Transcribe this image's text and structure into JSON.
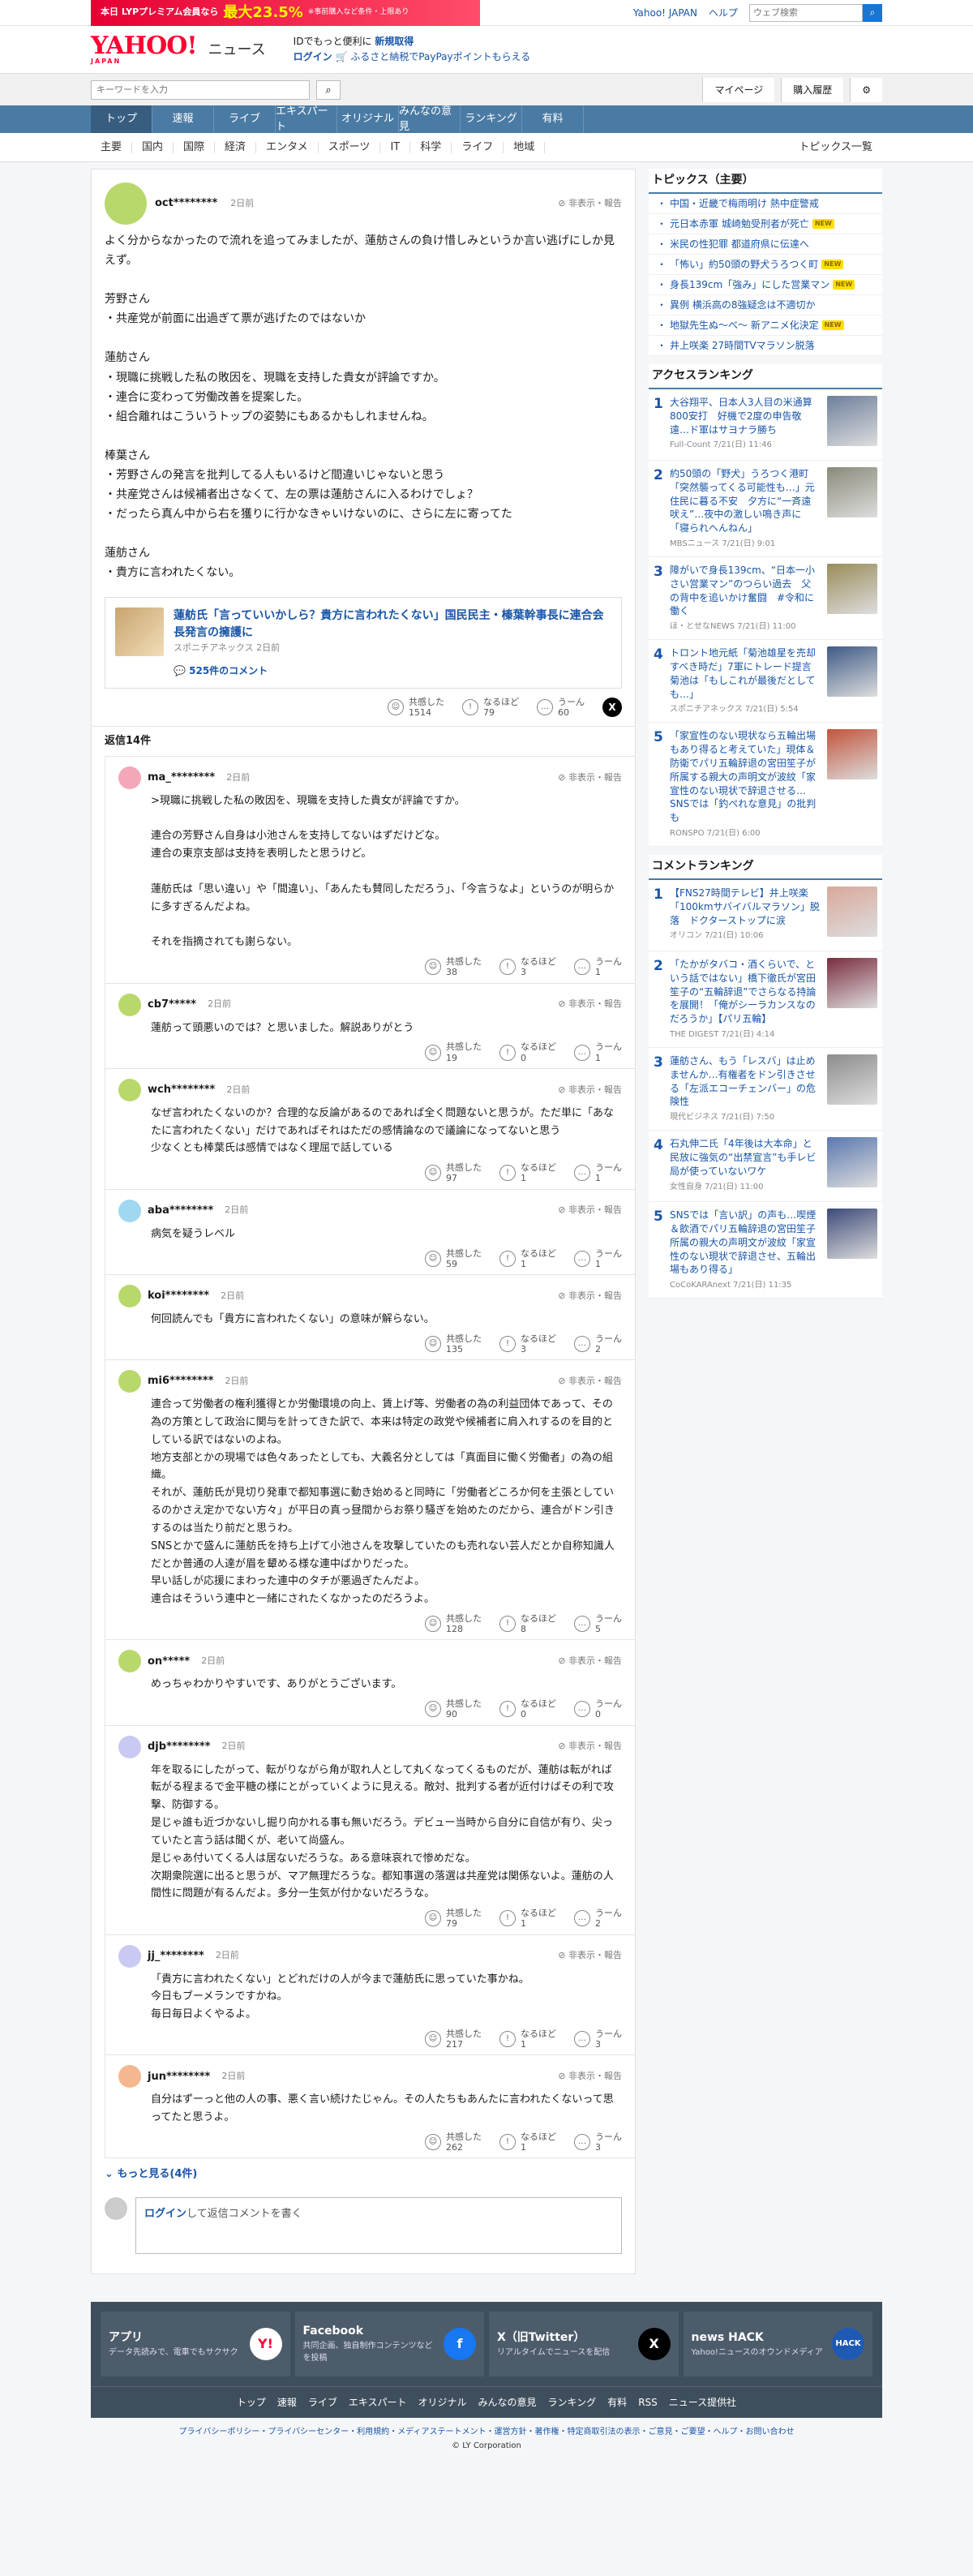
{
  "promo": {
    "label": "本日 LYPプレミアム会員なら",
    "pct": "最大23.5%",
    "note": "※事前購入など条件・上限あり"
  },
  "topbar": {
    "links": [
      "Yahoo! JAPAN",
      "ヘルプ"
    ],
    "search_placeholder": "ウェブ検索"
  },
  "brand": {
    "logo": "YAHOO!",
    "logo_sub": "JAPAN",
    "section": "ニュース",
    "id_text": "IDでもっと便利に",
    "id_link": "新規取得",
    "login": "ログイン",
    "furusato": "ふるさと納税でPayPayポイントもらえる"
  },
  "search": {
    "placeholder": "キーワードを入力",
    "mypage": "マイページ",
    "history": "購入履歴"
  },
  "mainnav": [
    "トップ",
    "速報",
    "ライブ",
    "エキスパート",
    "オリジナル",
    "みんなの意見",
    "ランキング",
    "有料"
  ],
  "subnav": [
    "主要",
    "国内",
    "国際",
    "経済",
    "エンタメ",
    "スポーツ",
    "IT",
    "科学",
    "ライフ",
    "地域"
  ],
  "subnav_right": "トピックス一覧",
  "comment": {
    "user": "oct********",
    "ago": "2日前",
    "report": "非表示・報告",
    "body": "よく分からなかったので流れを追ってみましたが、蓮舫さんの負け惜しみというか言い逃げにしか見えず。\n\n芳野さん\n・共産党が前面に出過ぎて票が逃げたのではないか\n\n蓮舫さん\n・現職に挑戦した私の敗因を、現職を支持した貴女が評論ですか。\n・連合に変わって労働改善を提案した。\n・組合離れはこういうトップの姿勢にもあるかもしれませんね。\n\n棒葉さん\n・芳野さんの発言を批判してる人もいるけど間違いじゃないと思う\n・共産党さんは候補者出さなくて、左の票は蓮舫さんに入るわけでしょ？\n・だったら真ん中から右を獲りに行かなきゃいけないのに、さらに左に寄ってた\n\n蓮舫さん\n・貴方に言われたくない。",
    "card": {
      "title": "蓮舫氏「言っていいかしら？貴方に言われたくない」国民民主・榛葉幹事長に連合会長発言の擁護に",
      "meta": "スポニチアネックス 2日前",
      "count": "525件のコメント"
    },
    "reactions": [
      {
        "label": "共感した",
        "count": "1514"
      },
      {
        "label": "なるほど",
        "count": "79"
      },
      {
        "label": "うーん",
        "count": "60"
      }
    ],
    "reply_count": "返信14件"
  },
  "colors": {
    "avatar_main": "#b9d86c",
    "accent": "#1855a8",
    "nav": "#4a7ba4"
  },
  "reaction_labels": [
    "共感した",
    "なるほど",
    "うーん"
  ],
  "replies": [
    {
      "user": "ma_********",
      "ago": "2日前",
      "avatar": "#f4a7b9",
      "body": ">現職に挑戦した私の敗因を、現職を支持した貴女が評論ですか。\n\n連合の芳野さん自身は小池さんを支持してないはずだけどな。\n連合の東京支部は支持を表明したと思うけど。\n\n蓮舫氏は「思い違い」や「間違い」、「あんたも賛同しただろう」、「今言うなよ」というのが明らかに多すぎるんだよね。\n\nそれを指摘されても謝らない。",
      "counts": [
        "38",
        "3",
        "1"
      ]
    },
    {
      "user": "cb7*****",
      "ago": "2日前",
      "avatar": "#b9d86c",
      "body": "蓮舫って頭悪いのでは？と思いました。解説ありがとう",
      "counts": [
        "19",
        "0",
        "1"
      ]
    },
    {
      "user": "wch********",
      "ago": "2日前",
      "avatar": "#b9d86c",
      "body": "なぜ言われたくないのか？合理的な反論があるのであれば全く問題ないと思うが。ただ単に「あなたに言われたくない」だけであればそれはただの感情論なので議論になってないと思う\n少なくとも棒葉氏は感情ではなく理屈で話している",
      "counts": [
        "97",
        "1",
        "1"
      ]
    },
    {
      "user": "aba********",
      "ago": "2日前",
      "avatar": "#9fd8f0",
      "body": "病気を疑うレベル",
      "counts": [
        "59",
        "1",
        "1"
      ]
    },
    {
      "user": "koi********",
      "ago": "2日前",
      "avatar": "#b9d86c",
      "body": "何回読んでも「貴方に言われたくない」の意味が解らない。",
      "counts": [
        "135",
        "3",
        "2"
      ]
    },
    {
      "user": "mi6********",
      "ago": "2日前",
      "avatar": "#b9d86c",
      "body": "連合って労働者の権利獲得とか労働環境の向上、賃上げ等、労働者の為の利益団体であって、その為の方策として政治に関与を計ってきた訳で、本来は特定の政党や候補者に肩入れするのを目的としている訳ではないのよね。\n地方支部とかの現場では色々あったとしても、大義名分としては「真面目に働く労働者」の為の組織。\nそれが、蓮舫氏が見切り発車で都知事選に動き始めると同時に「労働者どころか何を主張としているのかさえ定かでない方々」が平日の真っ昼間からお祭り騒ぎを始めたのだから、連合がドン引きするのは当たり前だと思うわ。\nSNSとかで盛んに蓮舫氏を持ち上げて小池さんを攻撃していたのも売れない芸人だとか自称知識人だとか普通の人達が眉を顰める様な連中ばかりだった。\n早い話しが応援にまわった連中のタチが悪過ぎたんだよ。\n連合はそういう連中と一緒にされたくなかったのだろうよ。",
      "counts": [
        "128",
        "8",
        "5"
      ]
    },
    {
      "user": "on*****",
      "ago": "2日前",
      "avatar": "#b9d86c",
      "body": "めっちゃわかりやすいです、ありがとうございます。",
      "counts": [
        "90",
        "0",
        "0"
      ]
    },
    {
      "user": "djb********",
      "ago": "2日前",
      "avatar": "#c9c9f2",
      "body": "年を取るにしたがって、転がりながら角が取れ人として丸くなってくるものだが、蓮舫は転がれば転がる程まるで金平糖の様にとがっていくように見える。敵対、批判する者が近付けばその利で攻撃、防御する。\n是じゃ誰も近づかないし掘り向かれる事も無いだろう。デビュー当時から自分に自信が有り、尖っていたと言う話は聞くが、老いて尚盛ん。\n是じゃあ付いてくる人は居ないだろうな。ある意味哀れで惨めだな。\n次期衆院選に出ると思うが、マア無理だろうな。都知事選の落選は共産党は関係ないよ。蓮舫の人間性に問題が有るんだよ。多分一生気が付かないだろうな。",
      "counts": [
        "79",
        "1",
        "2"
      ]
    },
    {
      "user": "jj_********",
      "ago": "2日前",
      "avatar": "#c9c9f2",
      "body": "「貴方に言われたくない」とどれだけの人が今まで蓮舫氏に思っていた事かね。\n今日もブーメランですかね。\n毎日毎日よくやるよ。",
      "counts": [
        "217",
        "1",
        "3"
      ]
    },
    {
      "user": "jun********",
      "ago": "2日前",
      "avatar": "#f4b78f",
      "body": "自分はずーっと他の人の事、悪く言い続けたじゃん。その人たちもあんたに言われたくないって思ってたと思うよ。",
      "counts": [
        "262",
        "1",
        "3"
      ]
    }
  ],
  "more": "もっと見る(4件)",
  "compose": {
    "login": "ログイン",
    "rest": "して返信コメントを書く"
  },
  "side": {
    "topics_title": "トピックス（主要）",
    "topics": [
      {
        "t": "中国・近畿で梅雨明け 熱中症警戒",
        "new": false
      },
      {
        "t": "元日本赤軍 城崎勉受刑者が死亡",
        "new": true
      },
      {
        "t": "米民の性犯罪 都道府県に伝達へ",
        "new": false
      },
      {
        "t": "「怖い」約50頭の野犬うろつく町",
        "new": true
      },
      {
        "t": "身長139cm「強み」にした営業マン",
        "new": true
      },
      {
        "t": "異例 横浜高の8強疑念は不適切か",
        "new": false
      },
      {
        "t": "地獄先生ぬ～べ～ 新アニメ化決定",
        "new": true
      },
      {
        "t": "井上咲楽 27時間TVマラソン脱落",
        "new": false
      }
    ],
    "access_title": "アクセスランキング",
    "access": [
      {
        "n": "1",
        "t": "大谷翔平、日本人3人目の米通算800安打　好機で2度の申告敬遠…ド軍はサヨナラ勝ち",
        "s": "Full-Count 7/21(日) 11:46",
        "c": "#6d7f9c"
      },
      {
        "n": "2",
        "t": "約50頭の「野犬」うろつく港町「突然襲ってくる可能性も…」元住民に暮る不安　夕方に“一斉遠吠え”…夜中の激しい鳴き声に「寝られへんねん」",
        "s": "MBSニュース 7/21(日) 9:01",
        "c": "#8a8a7a"
      },
      {
        "n": "3",
        "t": "障がいで身長139cm、“日本一小さい営業マン”のつらい過去　父の背中を追いかけ奮闘　#令和に働く",
        "s": "ほ・とせなNEWS 7/21(日) 11:00",
        "c": "#9a8c5a"
      },
      {
        "n": "4",
        "t": "トロント地元紙「菊池雄星を売却すべき時だ」7軍にトレード提言　菊池は「もしこれが最後だとしても…」",
        "s": "スポニチアネックス 7/21(日) 5:54",
        "c": "#3e5a86"
      },
      {
        "n": "5",
        "t": "「家宣性のない現状なら五輪出場もあり得ると考えていた」現体＆防衛でパリ五輪辞退の宮田笙子が所属する親大の声明文が波紋「家宣性のない現状で辞退させる…SNSでは「釣ぺれな意見」の批判も",
        "s": "RONSPO 7/21(日) 6:00",
        "c": "#c2543c"
      }
    ],
    "comment_title": "コメントランキング",
    "comment_rank": [
      {
        "n": "1",
        "t": "【FNS27時間テレビ】井上咲楽「100kmサバイバルマラソン」脱落　ドクターストップに涙",
        "s": "オリコン 7/21(日) 10:06",
        "c": "#d9a89a"
      },
      {
        "n": "2",
        "t": "「たかがタバコ・酒くらいで、という話ではない」橋下徹氏が宮田笙子の“五輪辞退”でさらなる持論を展開！「俺がシーラカンスなのだろうか」【パリ五輪】",
        "s": "THE DIGEST 7/21(日) 4:14",
        "c": "#7a2c3e"
      },
      {
        "n": "3",
        "t": "蓮舫さん、もう「レスバ」は止めませんか…有権者をドン引きさせる「左派エコーチェンバー」の危険性",
        "s": "現代ビジネス 7/21(日) 7:50",
        "c": "#8c8c8c"
      },
      {
        "n": "4",
        "t": "石丸伸二氏「4年後は大本命」と民放に強気の“出禁宣言”も手レビ局が使っていないワケ",
        "s": "女性自身 7/21(日) 11:00",
        "c": "#5a78b0"
      },
      {
        "n": "5",
        "t": "SNSでは「言い訳」の声も…喫煙＆飲酒でパリ五輪辞退の宮田笙子所属の親大の声明文が波紋「家宣性のない現状で辞退させ、五輪出場もあり得る」",
        "s": "CoCoKARAnext 7/21(日) 11:35",
        "c": "#3c4a78"
      }
    ]
  },
  "footer": {
    "apps": [
      {
        "t": "アプリ",
        "d": "データ先読みで、電車でもサクサク",
        "icon": "Y!",
        "bg": "#fff",
        "fg": "#ff0033"
      },
      {
        "t": "Facebook",
        "d": "共同企画、独自制作コンテンツなどを投稿",
        "icon": "f",
        "bg": "#1877f2",
        "fg": "#fff"
      },
      {
        "t": "X（旧Twitter）",
        "d": "リアルタイムでニュースを配信",
        "icon": "X",
        "bg": "#000",
        "fg": "#fff"
      },
      {
        "t": "news HACK",
        "d": "Yahoo!ニュースのオウンドメディア",
        "icon": "HACK",
        "bg": "#1e5ab4",
        "fg": "#fff"
      }
    ],
    "nav": [
      "トップ",
      "速報",
      "ライブ",
      "エキスパート",
      "オリジナル",
      "みんなの意見",
      "ランキング",
      "有料",
      "RSS",
      "ニュース提供社"
    ],
    "legal": "プライバシーポリシー・プライバシーセンター・利用規約・メディアステートメント・運営方針・著作権・特定商取引法の表示・ご意見・ご要望・ヘルプ・お問い合わせ",
    "copy": "© LY Corporation"
  }
}
